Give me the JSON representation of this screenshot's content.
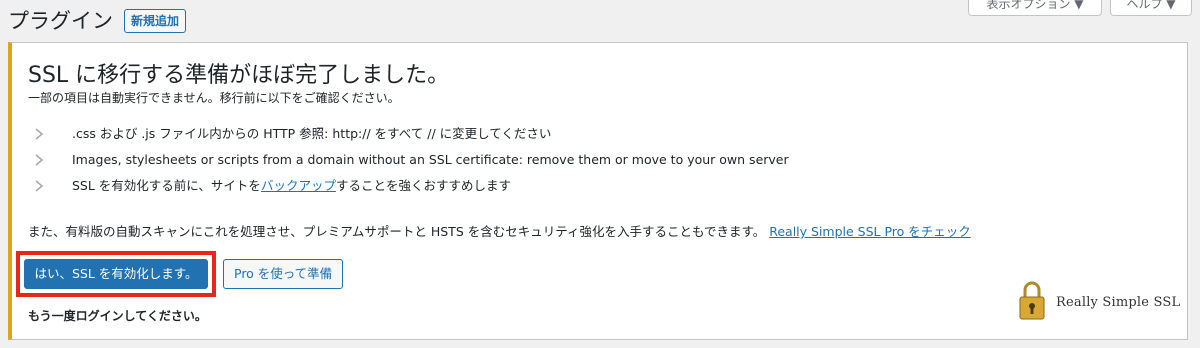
{
  "header": {
    "title": "プラグイン",
    "add_new_label": "新規追加",
    "screen_options_label": "表示オプション ▼",
    "help_label": "ヘルプ ▼"
  },
  "notice": {
    "title": "SSL に移行する準備がほぼ完了しました。",
    "subtitle": "一部の項目は自動実行できません。移行前に以下をご確認ください。",
    "items": [
      {
        "text": ".css および .js ファイル内からの HTTP 参照: http:// をすべて // に変更してください"
      },
      {
        "text": "Images, stylesheets or scripts from a domain without an SSL certificate: remove them or move to your own server"
      },
      {
        "before": "SSL を有効化する前に、サイトを",
        "link": "バックアップ",
        "after": "することを強くおすすめします"
      }
    ],
    "pro_text": "また、有料版の自動スキャンにこれを処理させ、プレミアムサポートと HSTS を含むセキュリティ強化を入手することもできます。",
    "pro_link": "Really Simple SSL Pro をチェック",
    "primary_button": "はい、SSL を有効化します。",
    "secondary_button": "Pro を使って準備",
    "relogin_text": "もう一度ログインしてください。",
    "logo_text": "Really Simple SSL"
  },
  "colors": {
    "accent": "#2271b1",
    "warning_border": "#dba617",
    "highlight": "#e8261c",
    "lock_gold": "#d9a733"
  }
}
